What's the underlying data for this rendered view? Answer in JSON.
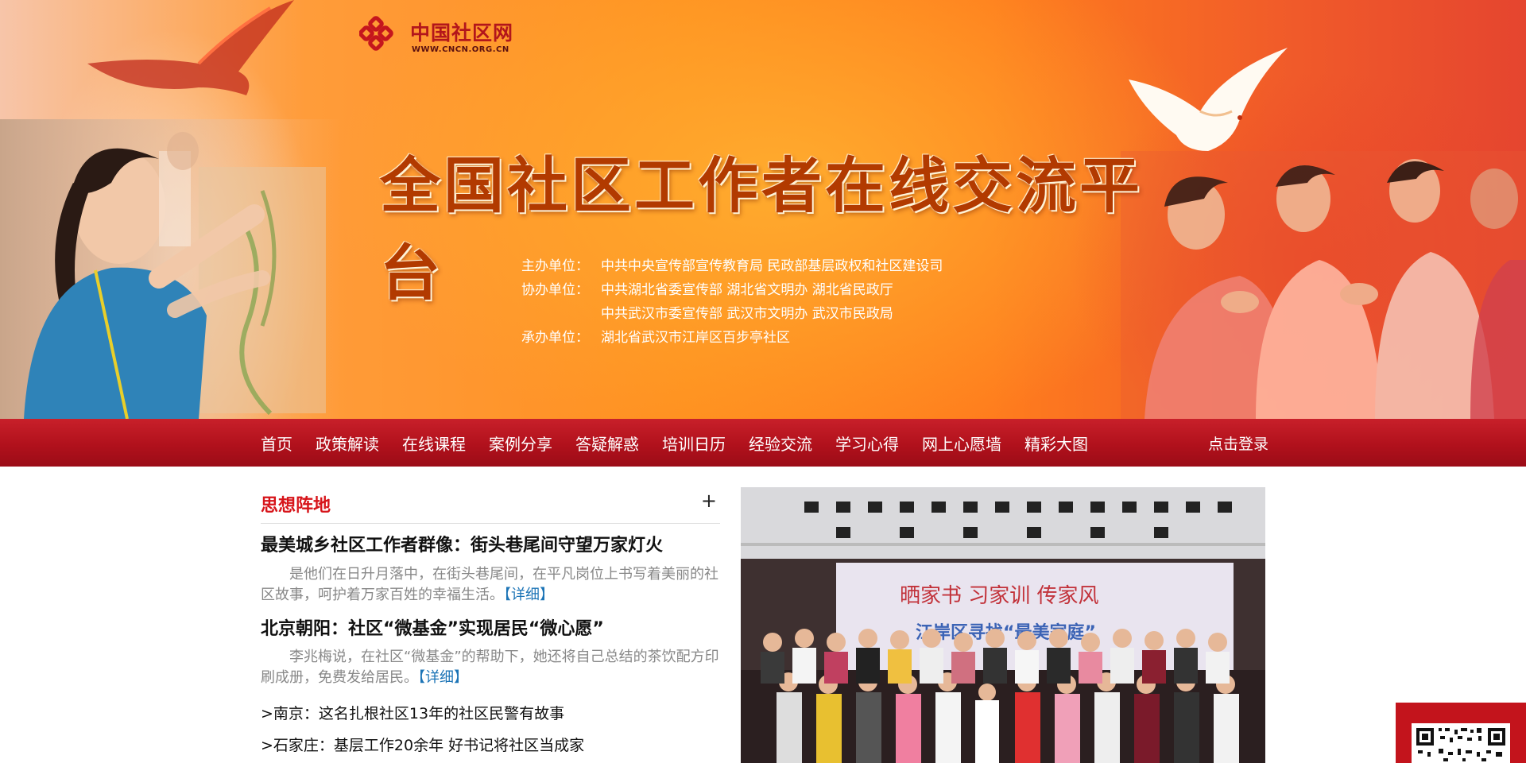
{
  "brand": {
    "name": "中国社区网",
    "url": "WWW.CNCN.ORG.CN"
  },
  "banner": {
    "title": "全国社区工作者在线交流平台",
    "organizers": [
      {
        "label": "主办单位：",
        "value": "中共中央宣传部宣传教育局  民政部基层政权和社区建设司"
      },
      {
        "label": "协办单位：",
        "value": "中共湖北省委宣传部  湖北省文明办  湖北省民政厅"
      },
      {
        "label": "",
        "value": "中共武汉市委宣传部  武汉市文明办  武汉市民政局"
      },
      {
        "label": "承办单位：",
        "value": "湖北省武汉市江岸区百步亭社区"
      }
    ]
  },
  "nav": {
    "items": [
      "首页",
      "政策解读",
      "在线课程",
      "案例分享",
      "答疑解惑",
      "培训日历",
      "经验交流",
      "学习心得",
      "网上心愿墙",
      "精彩大图"
    ],
    "login": "点击登录"
  },
  "section": {
    "title": "思想阵地",
    "more": "+"
  },
  "articles": [
    {
      "title": "最美城乡社区工作者群像：街头巷尾间守望万家灯火",
      "summary": "是他们在日升月落中，在街头巷尾间，在平凡岗位上书写着美丽的社区故事，呵护着万家百姓的幸福生活。",
      "detail": "【详细】"
    },
    {
      "title": "北京朝阳：社区“微基金”实现居民“微心愿”",
      "summary": "李兆梅说，在社区“微基金”的帮助下，她还将自己总结的茶饮配方印刷成册，免费发给居民。",
      "detail": "【详细】"
    }
  ],
  "list": [
    ">南京：这名扎根社区13年的社区民警有故事",
    ">石家庄：基层工作20余年 好书记将社区当成家"
  ],
  "photo": {
    "stage_banner_line1": "晒家书  习家训  传家风",
    "stage_banner_line2": "江岸区寻找“最美家庭”"
  },
  "colors": {
    "nav_red": "#b1111c",
    "section_red": "#d7141a",
    "detail_blue": "#1c74b6",
    "banner_orange": "#ff8f1f"
  }
}
